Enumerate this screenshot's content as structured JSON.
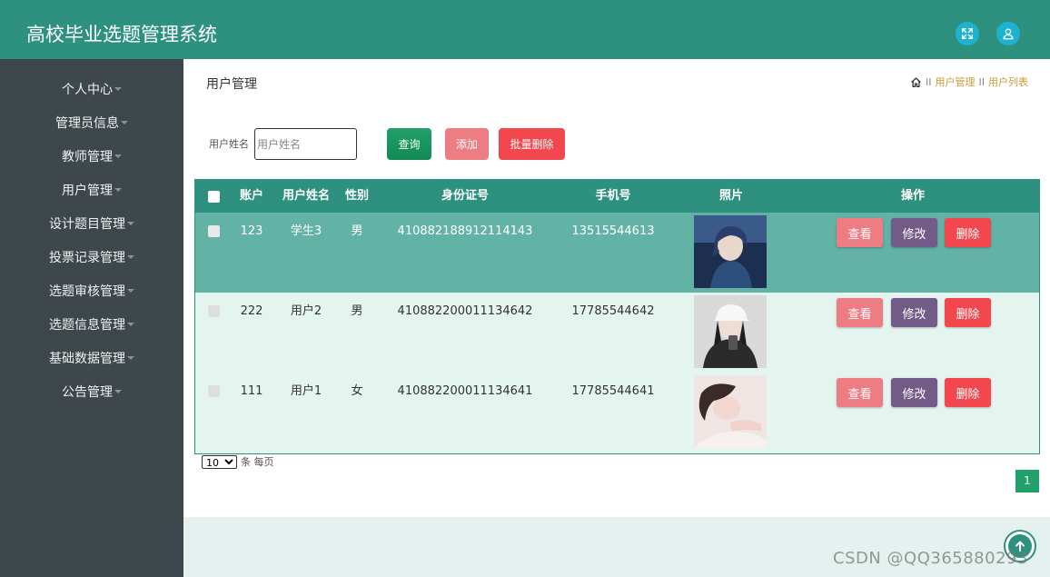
{
  "header": {
    "title": "高校毕业选题管理系统",
    "icons": [
      "fullscreen-icon",
      "user-icon"
    ],
    "bg_color": "#2e9180",
    "icon_color": "#1bb3cf"
  },
  "sidebar": {
    "items": [
      {
        "label": "个人中心"
      },
      {
        "label": "管理员信息"
      },
      {
        "label": "教师管理"
      },
      {
        "label": "用户管理"
      },
      {
        "label": "设计题目管理"
      },
      {
        "label": "投票记录管理"
      },
      {
        "label": "选题审核管理"
      },
      {
        "label": "选题信息管理"
      },
      {
        "label": "基础数据管理"
      },
      {
        "label": "公告管理"
      }
    ],
    "bg_color": "#3e474b"
  },
  "page": {
    "title": "用户管理",
    "breadcrumb": {
      "sep1": "II",
      "item1": "用户管理",
      "sep2": "II",
      "item2": "用户列表"
    }
  },
  "search": {
    "label": "用户姓名",
    "placeholder": "用户姓名",
    "value": "",
    "query_label": "查询",
    "add_label": "添加",
    "batch_delete_label": "批量删除"
  },
  "table": {
    "headers": {
      "account": "账户",
      "name": "用户姓名",
      "gender": "性别",
      "id_number": "身份证号",
      "phone": "手机号",
      "photo": "照片",
      "actions": "操作"
    },
    "rows": [
      {
        "account": "123",
        "name": "学生3",
        "gender": "男",
        "id_number": "410882188912114143",
        "phone": "13515544613",
        "photo": "avatar-anime-boy"
      },
      {
        "account": "222",
        "name": "用户2",
        "gender": "男",
        "id_number": "410882200011134642",
        "phone": "17785544642",
        "photo": "avatar-girl-white-cap"
      },
      {
        "account": "111",
        "name": "用户1",
        "gender": "女",
        "id_number": "410882200011134641",
        "phone": "17785544641",
        "photo": "avatar-girl-lying"
      }
    ],
    "action_labels": {
      "view": "查看",
      "edit": "修改",
      "delete": "删除"
    },
    "header_bg": "#2e9180",
    "row_colors": [
      "#62b3a5",
      "#e4f5ef",
      "#e4f5ef"
    ]
  },
  "pagination": {
    "page_size": "10",
    "page_size_options": [
      "10"
    ],
    "page_size_suffix": "条 每页",
    "current_page": "1"
  },
  "watermark": "CSDN @QQ365880293"
}
